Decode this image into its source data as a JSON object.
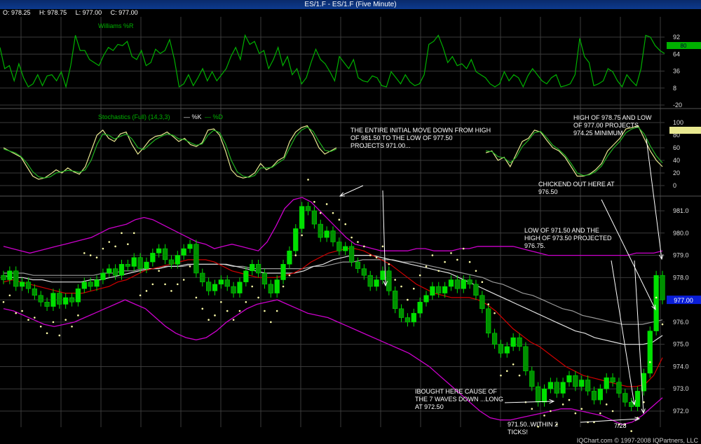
{
  "window": {
    "title": "ES/1.F - ES/1.F (Five Minute)"
  },
  "ohlc": {
    "open": "O: 978.25",
    "high": "H: 978.75",
    "low": "L: 977.00",
    "close": "C: 977.00"
  },
  "footer": "IQChart.com © 1997-2008 IQPartners, LLC",
  "colors": {
    "up": "#00e000",
    "down": "#00a000",
    "bb": "#cc00cc",
    "ema": "#d00000",
    "ma_white": "#e0e0e0",
    "ma_gray": "#9a9a9a",
    "sar": "#ffffaa",
    "grid": "#3a3a3a",
    "wr": "#00b000",
    "stK": "#e8e890",
    "stD": "#20b020",
    "price_tag": "#0a1ed8"
  },
  "annotations": {
    "a1": "THE ENTIRE INITIAL MOVE DOWN FROM HIGH\nOF 981.50 TO THE LOW OF 977.50\nPROJECTS 971.00...",
    "a2": "HIGH OF 978.75 AND LOW\nOF 977.00 PROJECTS\n974.25 MINIMUM",
    "a3": "CHICKEND OUT HERE AT\n976.50",
    "a4": "LOW OF 971.50 AND THE\nHIGH OF 973.50 PROJECTED\n976.75.",
    "a5": "IBOUGHT HERE CAUSE OF\nTHE 7 WAVES DOWN ...LONG\nAT 972.50",
    "a6": "971.50..WITHIN 2\nTICKS!",
    "date": "7/28"
  },
  "chart_data": [
    {
      "type": "line",
      "title": "Williams %R",
      "y_ticks": [
        "92",
        "64",
        "36",
        "8",
        "-20"
      ],
      "ylim": [
        -20,
        100
      ],
      "last_value_tag": "80",
      "series": [
        {
          "name": "Williams %R",
          "values": [
            75,
            40,
            45,
            20,
            48,
            25,
            10,
            15,
            30,
            12,
            28,
            30,
            20,
            35,
            10,
            45,
            95,
            70,
            70,
            55,
            50,
            45,
            62,
            75,
            70,
            80,
            78,
            85,
            60,
            55,
            70,
            45,
            50,
            72,
            65,
            70,
            88,
            55,
            10,
            15,
            30,
            12,
            25,
            40,
            20,
            35,
            20,
            30,
            40,
            60,
            75,
            55,
            95,
            80,
            85,
            65,
            70,
            40,
            55,
            75,
            45,
            60,
            30,
            40,
            15,
            25,
            50,
            72,
            55,
            48,
            35,
            20,
            60,
            50,
            40,
            55,
            25,
            20,
            18,
            28,
            25,
            12,
            10,
            35,
            25,
            15,
            30,
            18,
            12,
            15,
            30,
            80,
            85,
            95,
            75,
            50,
            60,
            45,
            48,
            40,
            55,
            35,
            30,
            25,
            15,
            10,
            15,
            35,
            20,
            30,
            25,
            10,
            28,
            40,
            30,
            20,
            15,
            25,
            30,
            10,
            12,
            15,
            30,
            90,
            60,
            50,
            12,
            15,
            20,
            40,
            35,
            20,
            10,
            30,
            20,
            12,
            40,
            95,
            92,
            78,
            70,
            65
          ]
        }
      ]
    },
    {
      "type": "line",
      "title": "Stochastics (Full) (14,3,3)",
      "y_ticks": [
        "100",
        "80",
        "60",
        "40",
        "20",
        "0"
      ],
      "ylim": [
        0,
        100
      ],
      "series": [
        {
          "name": "%K",
          "values": [
            60,
            55,
            50,
            45,
            30,
            15,
            10,
            12,
            18,
            25,
            20,
            28,
            22,
            18,
            30,
            55,
            80,
            88,
            75,
            70,
            82,
            85,
            65,
            50,
            60,
            72,
            78,
            80,
            85,
            78,
            70,
            75,
            65,
            62,
            68,
            88,
            90,
            80,
            55,
            25,
            15,
            12,
            14,
            20,
            35,
            25,
            30,
            40,
            45,
            70,
            85,
            92,
            95,
            80,
            60,
            50,
            55,
            60,
            52,
            55,
            40,
            45,
            30,
            50,
            70,
            75,
            88,
            85,
            72,
            60,
            55,
            45,
            30,
            15,
            15,
            18,
            25,
            35,
            55,
            65,
            75,
            90,
            92,
            95,
            75,
            55,
            40,
            30
          ]
        },
        {
          "name": "%D",
          "values": [
            58,
            55,
            52,
            46,
            36,
            22,
            14,
            12,
            14,
            20,
            22,
            24,
            23,
            21,
            25,
            40,
            65,
            82,
            80,
            74,
            78,
            82,
            74,
            60,
            57,
            65,
            73,
            78,
            82,
            80,
            74,
            73,
            68,
            64,
            66,
            80,
            88,
            84,
            66,
            40,
            22,
            15,
            13,
            16,
            28,
            28,
            29,
            36,
            42,
            60,
            78,
            88,
            93,
            86,
            70,
            56,
            54,
            58,
            55,
            54,
            46,
            44,
            36,
            45,
            62,
            72,
            84,
            86,
            76,
            64,
            57,
            48,
            35,
            20,
            16,
            17,
            22,
            31,
            47,
            60,
            70,
            84,
            90,
            93,
            82,
            63,
            47,
            36
          ]
        }
      ]
    },
    {
      "type": "candlestick",
      "y_ticks": [
        "981.0",
        "980.0",
        "979.0",
        "978.0",
        "977.0",
        "976.0",
        "975.0",
        "974.0",
        "973.0",
        "972.0"
      ],
      "ylim": [
        971.3,
        981.6
      ],
      "last_price_tag": "977.00",
      "closes": [
        977.9,
        978.3,
        977.6,
        977.8,
        977.5,
        977.2,
        976.9,
        976.7,
        977.3,
        976.8,
        977.1,
        976.9,
        977.5,
        977.8,
        977.6,
        977.9,
        978.2,
        978.4,
        978.1,
        978.6,
        978.5,
        978.9,
        978.4,
        978.7,
        979.1,
        979.3,
        978.8,
        978.6,
        979.0,
        979.3,
        979.5,
        978.2,
        977.8,
        977.4,
        977.7,
        977.9,
        977.6,
        977.3,
        977.8,
        978.3,
        978.6,
        978.2,
        977.7,
        977.3,
        977.9,
        978.6,
        979.2,
        980.2,
        981.2,
        981.0,
        980.4,
        979.8,
        980.1,
        979.6,
        979.2,
        979.4,
        978.7,
        978.4,
        978.1,
        977.6,
        977.9,
        978.3,
        977.4,
        976.6,
        976.2,
        976.0,
        976.4,
        976.9,
        977.2,
        977.6,
        977.3,
        977.6,
        977.9,
        977.5,
        977.9,
        977.7,
        977.2,
        976.6,
        975.5,
        975.0,
        974.6,
        974.9,
        975.3,
        974.9,
        973.8,
        973.1,
        972.4,
        973.0,
        973.3,
        972.8,
        973.3,
        973.6,
        973.1,
        973.4,
        972.9,
        972.5,
        973.0,
        973.5,
        973.3,
        972.8,
        972.4,
        972.2,
        972.9,
        973.7,
        975.6,
        978.1,
        977.0
      ],
      "bb_upper": [
        979.4,
        979.3,
        979.2,
        979.1,
        979.2,
        979.3,
        979.4,
        979.5,
        979.6,
        979.7,
        979.8,
        980.0,
        980.2,
        980.3,
        980.4,
        980.6,
        980.7,
        980.6,
        980.4,
        980.2,
        980.0,
        979.8,
        979.6,
        979.5,
        979.3,
        979.4,
        979.5,
        979.4,
        979.3,
        979.2,
        979.6,
        980.3,
        981.1,
        981.5,
        981.6,
        981.4,
        981.0,
        980.6,
        980.2,
        979.8,
        979.5,
        979.4,
        979.3,
        979.2,
        979.2,
        979.2,
        979.2,
        979.3,
        979.3,
        979.2,
        979.2,
        979.2,
        979.3,
        979.3,
        979.4,
        979.4,
        979.4,
        979.4,
        979.4,
        979.3,
        979.2,
        979.1,
        979.0,
        979.0,
        979.0,
        979.0,
        979.0,
        979.0,
        979.0,
        979.0,
        979.0,
        979.0,
        979.1,
        979.1,
        979.1,
        979.2
      ],
      "bb_lower": [
        976.6,
        976.5,
        976.3,
        976.1,
        975.9,
        975.8,
        975.9,
        976.0,
        976.2,
        976.4,
        976.6,
        976.8,
        977.0,
        976.8,
        976.6,
        976.2,
        975.8,
        975.5,
        975.3,
        975.2,
        975.3,
        975.6,
        976.0,
        976.3,
        976.6,
        976.8,
        976.9,
        977.0,
        976.8,
        976.6,
        976.4,
        976.3,
        976.2,
        976.0,
        975.8,
        975.6,
        975.4,
        975.2,
        975.0,
        974.8,
        974.6,
        974.3,
        974.0,
        973.6,
        973.2,
        972.8,
        972.4,
        972.0,
        971.7,
        971.6,
        971.6,
        971.7,
        971.8,
        971.9,
        972.0,
        972.1,
        972.1,
        972.0,
        971.9,
        971.8,
        971.6,
        971.4,
        971.5,
        971.8,
        972.2,
        972.6
      ],
      "ema": [
        977.8,
        977.9,
        977.8,
        977.7,
        977.6,
        977.5,
        977.4,
        977.3,
        977.3,
        977.3,
        977.4,
        977.5,
        977.6,
        977.8,
        977.9,
        978.1,
        978.3,
        978.4,
        978.5,
        978.6,
        978.7,
        978.8,
        978.8,
        978.8,
        978.7,
        978.5,
        978.3,
        978.2,
        978.1,
        978.0,
        978.0,
        978.0,
        978.1,
        978.2,
        978.4,
        978.7,
        978.9,
        979.1,
        979.2,
        979.3,
        979.3,
        979.2,
        979.0,
        978.8,
        978.6,
        978.3,
        978.0,
        977.7,
        977.5,
        977.3,
        977.2,
        977.1,
        977.1,
        977.1,
        977.0,
        976.8,
        976.5,
        976.1,
        975.7,
        975.4,
        975.1,
        974.9,
        974.6,
        974.3,
        974.0,
        973.8,
        973.6,
        973.5,
        973.4,
        973.3,
        973.2,
        973.1,
        973.1,
        973.2,
        973.6,
        974.4
      ],
      "ma_white": [
        978.1,
        978.0,
        978.0,
        977.9,
        977.9,
        977.8,
        977.8,
        977.8,
        977.8,
        977.9,
        977.9,
        978.0,
        978.1,
        978.2,
        978.3,
        978.4,
        978.4,
        978.5,
        978.5,
        978.6,
        978.6,
        978.6,
        978.6,
        978.6,
        978.5,
        978.4,
        978.3,
        978.2,
        978.2,
        978.2,
        978.2,
        978.3,
        978.5,
        978.6,
        978.8,
        978.9,
        979.0,
        979.0,
        979.0,
        978.9,
        978.8,
        978.7,
        978.6,
        978.5,
        978.4,
        978.3,
        978.2,
        978.0,
        977.8,
        977.6,
        977.4,
        977.2,
        977.0,
        976.8,
        976.6,
        976.4,
        976.2,
        976.0,
        975.8,
        975.6,
        975.5,
        975.3,
        975.2,
        975.1,
        975.0,
        975.0,
        975.0,
        975.1,
        975.4
      ],
      "ma_gray": [
        978.2,
        978.2,
        978.2,
        978.1,
        978.1,
        978.1,
        978.1,
        978.1,
        978.1,
        978.1,
        978.2,
        978.2,
        978.3,
        978.3,
        978.4,
        978.4,
        978.5,
        978.5,
        978.5,
        978.6,
        978.6,
        978.6,
        978.6,
        978.5,
        978.5,
        978.4,
        978.4,
        978.4,
        978.4,
        978.4,
        978.4,
        978.5,
        978.5,
        978.6,
        978.7,
        978.7,
        978.8,
        978.8,
        978.8,
        978.8,
        978.7,
        978.7,
        978.6,
        978.5,
        978.4,
        978.3,
        978.2,
        978.1,
        978.0,
        977.8,
        977.7,
        977.5,
        977.3,
        977.2,
        977.0,
        976.8,
        976.6,
        976.5,
        976.3,
        976.2,
        976.1,
        976.0,
        975.9,
        975.9,
        975.9,
        976.0,
        976.1
      ]
    }
  ]
}
